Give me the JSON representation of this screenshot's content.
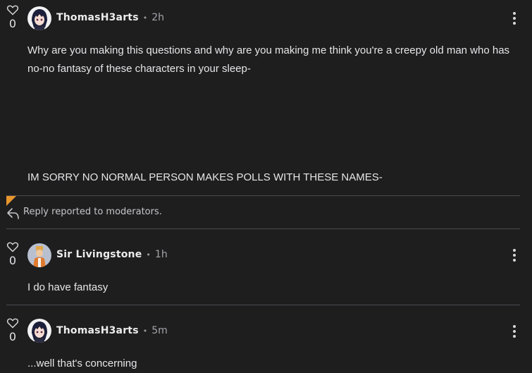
{
  "comments": [
    {
      "user": "ThomasH3arts",
      "time": "2h",
      "votes": "0",
      "lines": [
        "Why are you making this questions and why are you making me think you're a creepy old man who has no-no fantasy of these characters in your sleep-",
        "IM SORRY NO NORMAL PERSON MAKES POLLS WITH THESE NAMES-"
      ]
    },
    {
      "user": "Sir Livingstone",
      "time": "1h",
      "votes": "0",
      "lines": [
        "I do have fantasy"
      ]
    },
    {
      "user": "ThomasH3arts",
      "time": "5m",
      "votes": "0",
      "lines": [
        "...well that's concerning"
      ]
    }
  ],
  "reported": {
    "label": "Reply reported to moderators."
  },
  "separator": "•",
  "colors": {
    "background": "#1e1e1f",
    "flag": "#e8962c",
    "divider": "#4b4b4e"
  },
  "icons": {
    "vote": "heart-icon",
    "menu": "more-vertical-icon",
    "reply": "reply-arrow-icon"
  }
}
